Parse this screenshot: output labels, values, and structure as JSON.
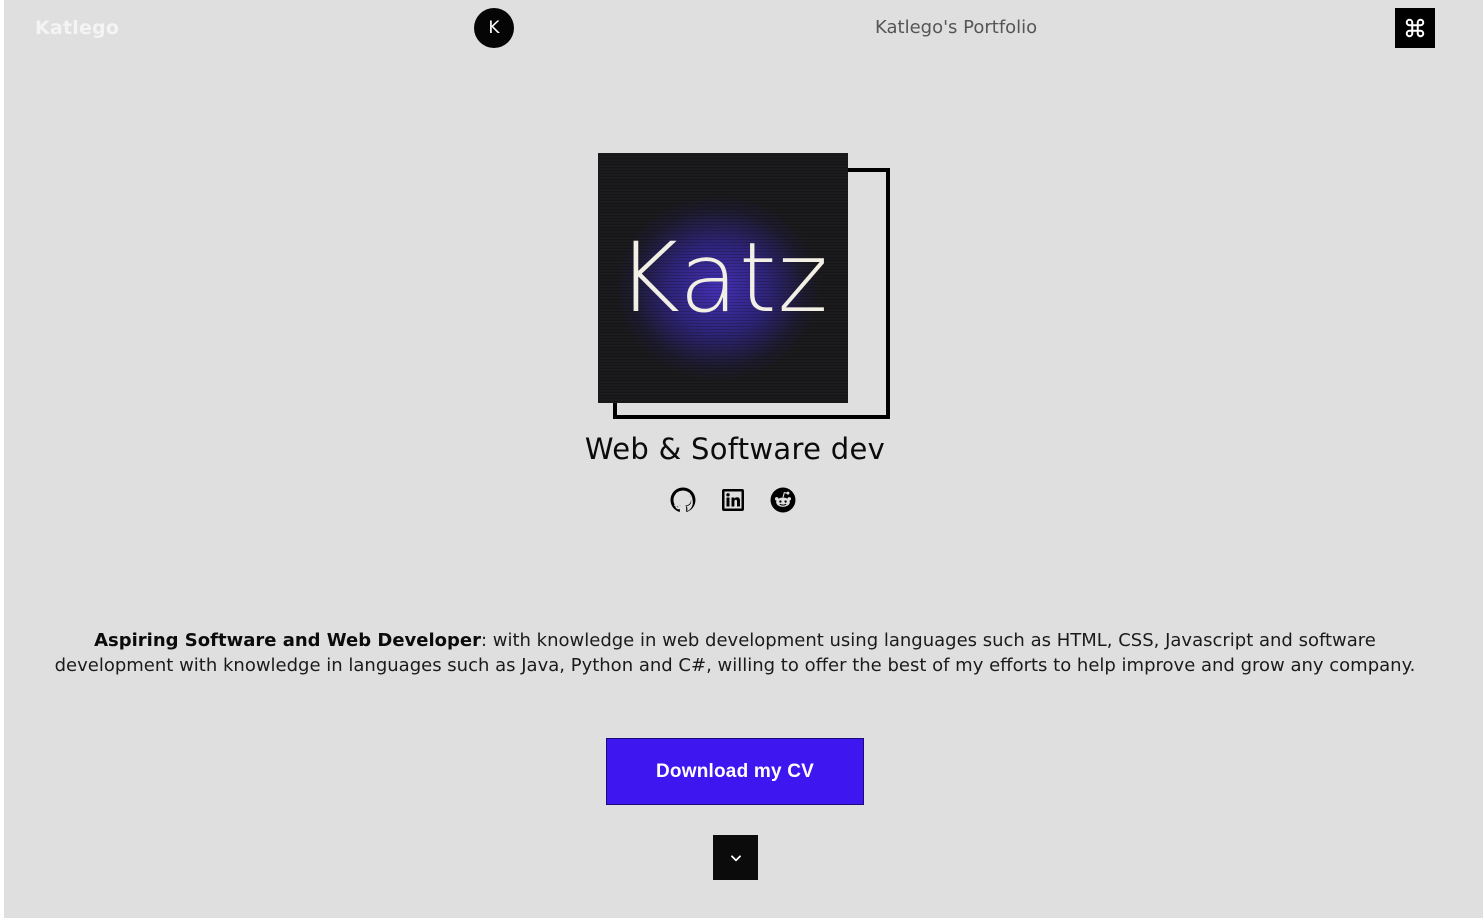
{
  "header": {
    "brand": "Katlego",
    "avatar_letter": "K",
    "title": "Katlego's Portfolio",
    "menu_icon": "command-icon"
  },
  "hero": {
    "photo_text": "Katz",
    "headline": "Web & Software dev",
    "socials": [
      {
        "name": "github",
        "icon": "github-icon"
      },
      {
        "name": "linkedin",
        "icon": "linkedin-icon"
      },
      {
        "name": "reddit",
        "icon": "reddit-icon"
      }
    ]
  },
  "bio": {
    "lead": "Aspiring Software and Web Developer",
    "text": ": with knowledge in web development using languages such as HTML, CSS, Javascript and software development with knowledge in languages such as Java, Python and C#, willing to offer the best of my efforts to help improve and grow any company."
  },
  "actions": {
    "cv_label": "Download my CV",
    "scroll_icon": "chevron-down-icon"
  },
  "colors": {
    "page_background": "#dfdfdf",
    "accent": "#3d16f0",
    "dark": "#000000"
  }
}
